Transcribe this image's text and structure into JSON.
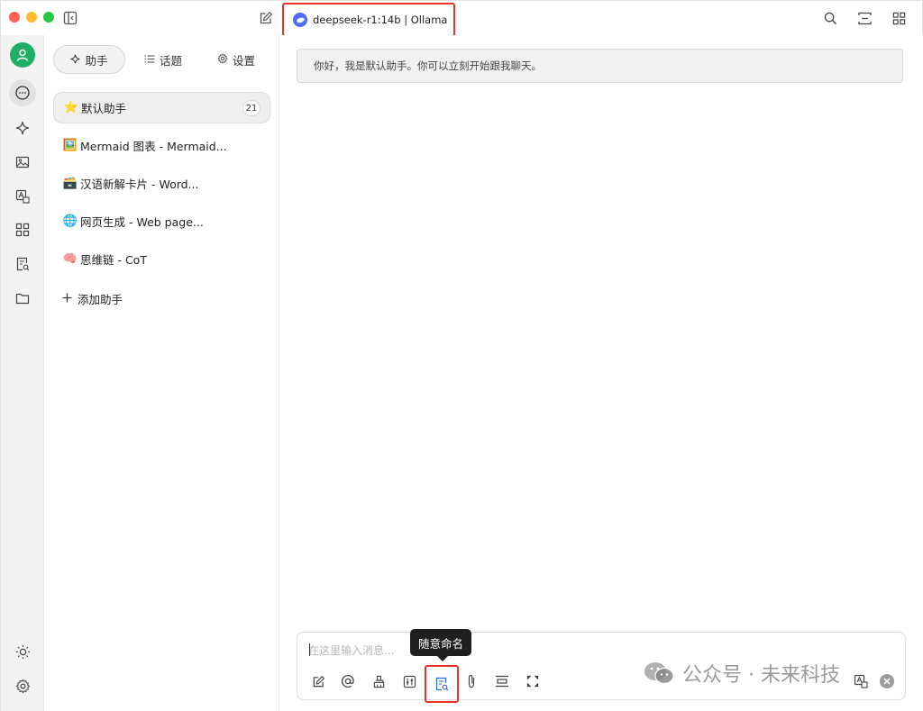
{
  "titlebar": {
    "model_label": "deepseek-r1:14b | Ollama"
  },
  "panel": {
    "tabs": [
      {
        "label": "助手",
        "icon": "sparkle-icon"
      },
      {
        "label": "话题",
        "icon": "list-icon"
      },
      {
        "label": "设置",
        "icon": "gear-icon"
      }
    ],
    "assistants": [
      {
        "emoji": "⭐",
        "label": "默认助手",
        "count": "21"
      },
      {
        "emoji": "🖼️",
        "label": "Mermaid 图表 - Mermaid..."
      },
      {
        "emoji": "🗃️",
        "label": "汉语新解卡片 - Word..."
      },
      {
        "emoji": "🌐",
        "label": "网页生成 - Web page..."
      },
      {
        "emoji": "🧠",
        "label": "思维链 - CoT"
      }
    ],
    "add_assistant_label": "添加助手"
  },
  "chat": {
    "greeting": "你好，我是默认助手。你可以立刻开始跟我聊天。"
  },
  "composer": {
    "placeholder": "在这里输入消息...",
    "tooltip": "随意命名"
  },
  "watermark": {
    "text": "公众号 · 未来科技"
  },
  "colors": {
    "highlight": "#e8322c",
    "avatar": "#1fb067",
    "deepseek": "#4d6bfe"
  }
}
